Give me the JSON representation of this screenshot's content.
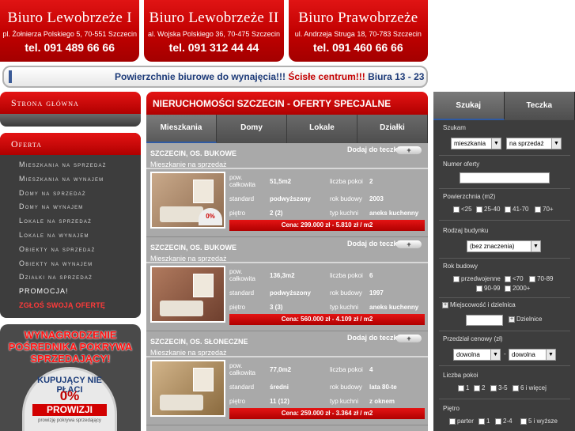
{
  "offices": [
    {
      "name": "Biuro Lewobrzeże I",
      "address": "pl. Żołnierza Polskiego 5, 70-551 Szczecin",
      "tel": "tel. 091 489 66 66"
    },
    {
      "name": "Biuro Lewobrzeże II",
      "address": "al. Wojska Polskiego 36, 70-475 Szczecin",
      "tel": "tel. 091 312 44 44"
    },
    {
      "name": "Biuro Prawobrzeże",
      "address": "ul. Andrzeja Struga 18, 70-783 Szczecin",
      "tel": "tel. 091 460 66 66"
    }
  ],
  "ticker": {
    "part1": "Powierzchnie biurowe do wynajęcia!!!",
    "part2": "Ścisłe centrum!!!",
    "part3": "Biura 13 - 23 m"
  },
  "nav": {
    "home": "Strona główna",
    "offer": "Oferta",
    "items": [
      "Mieszkania na sprzedaż",
      "Mieszkania na wynajem",
      "Domy na sprzedaż",
      "Domy na wynajem",
      "Lokale na sprzedaż",
      "Lokale na wynajem",
      "Obiekty na sprzedaż",
      "Obiekty na wynajem",
      "Działki na sprzedaż"
    ],
    "promo": "PROMOCJA!",
    "report": "ZGŁOŚ SWOJĄ OFERTĘ"
  },
  "promo_box": {
    "title": "WYNAGRODZENIE POŚREDNIKA POKRYWA SPRZEDAJĄCY!",
    "badge_top": "KUPUJĄCY NIE PŁACI",
    "badge_pct": "0%",
    "badge_bar": "PROWIZJI",
    "badge_small": "prowizję pokrywa sprzedający"
  },
  "main": {
    "title": "NIERUCHOMOŚCI SZCZECIN - OFERTY SPECJALNE",
    "tabs": [
      "Mieszkania",
      "Domy",
      "Lokale",
      "Działki"
    ],
    "add_label": "Dodaj do teczki",
    "labels": {
      "area": "pow. całkowita",
      "rooms": "liczba pokoi",
      "standard": "standard",
      "year": "rok budowy",
      "floor": "piętro",
      "kitchen": "typ kuchni"
    }
  },
  "listings": [
    {
      "title": "SZCZECIN, OS. BUKOWE",
      "subtitle": "Mieszkanie na sprzedaż",
      "area": "51,5m2",
      "rooms": "2",
      "standard": "podwyższony",
      "year": "2003",
      "floor": "2 (2)",
      "kitchen": "aneks kuchenny",
      "price": "Cena: 299.000 zł - 5.810 zł / m2"
    },
    {
      "title": "SZCZECIN, OS. BUKOWE",
      "subtitle": "Mieszkanie na sprzedaż",
      "area": "136,3m2",
      "rooms": "6",
      "standard": "podwyższony",
      "year": "1997",
      "floor": "3 (3)",
      "kitchen": "aneks kuchenny",
      "price": "Cena: 560.000 zł - 4.109 zł / m2"
    },
    {
      "title": "SZCZECIN, OS. SŁONECZNE",
      "subtitle": "Mieszkanie na sprzedaż",
      "area": "77,0m2",
      "rooms": "4",
      "standard": "średni",
      "year": "lata 80-te",
      "floor": "11 (12)",
      "kitchen": "z oknem",
      "price": "Cena: 259.000 zł - 3.364 zł / m2"
    }
  ],
  "search": {
    "tabs": [
      "Szukaj",
      "Teczka"
    ],
    "szukam": "Szukam",
    "type_value": "mieszkania",
    "trans_value": "na sprzedaż",
    "offer_no": "Numer oferty",
    "area": "Powierzchnia (m2)",
    "area_opts": [
      "<25",
      "25-40",
      "41-70",
      "70+"
    ],
    "building": "Rodzaj budynku",
    "building_value": "(bez znaczenia)",
    "year": "Rok budowy",
    "year_opts": [
      "przedwojenne",
      "<70",
      "70-89",
      "90-99",
      "2000+"
    ],
    "locality": "Miejscowość i dzielnica",
    "district": "Dzielnice",
    "price": "Przedział cenowy (zł)",
    "price_from": "dowolna",
    "price_to": "dowolna",
    "price_sep": "-",
    "rooms": "Liczba pokoi",
    "rooms_opts": [
      "1",
      "2",
      "3-5",
      "6 i więcej"
    ],
    "floor": "Piętro",
    "floor_opts": [
      "parter",
      "1",
      "2-4",
      "5 i wyższe"
    ]
  }
}
